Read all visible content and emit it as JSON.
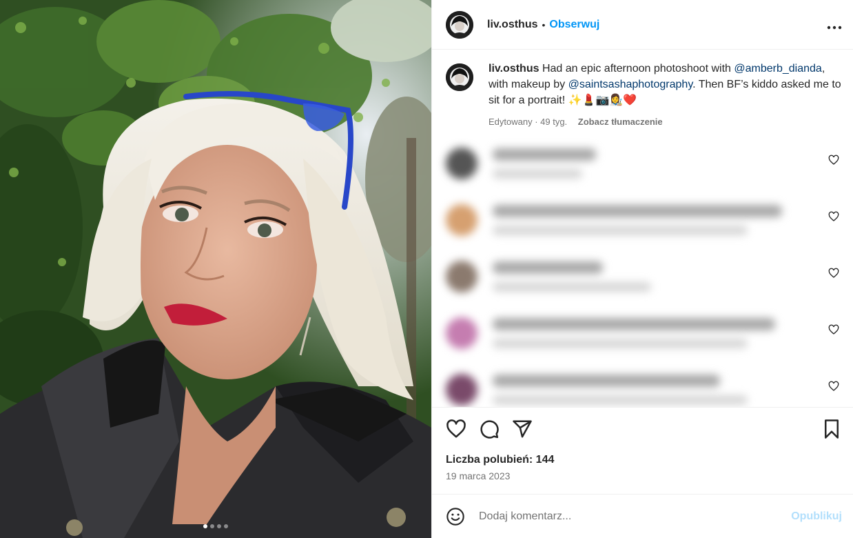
{
  "post": {
    "username": "liv.osthus",
    "separator": "•",
    "follow_label": "Obserwuj",
    "more_label": "•••"
  },
  "caption": {
    "username": "liv.osthus",
    "text_1": "Had an epic afternoon photoshoot with",
    "mention_1": "@amberb_dianda",
    "text_2": ", with makeup by",
    "mention_2": "@saintsashaphotography",
    "text_3": ". Then BF’s kiddo asked me to sit for a portrait!",
    "emojis": "✨💄📷👩‍🎨❤️",
    "edited": "Edytowany · 49 tyg.",
    "translate": "Zobacz tłumaczenie"
  },
  "likes": "Liczba polubień: 144",
  "date": "19 marca 2023",
  "comment_box": {
    "placeholder": "Dodaj komentarz...",
    "publish_label": "Opublikuj"
  },
  "carousel": {
    "count": 4,
    "active_index": 0
  },
  "colors": {
    "accent": "#0095f6",
    "mention": "#00376b",
    "publish_disabled": "#b2dffc",
    "muted_text": "#737373"
  },
  "icons": [
    "more-options-icon",
    "like-icon",
    "comment-icon",
    "share-icon",
    "save-icon",
    "emoji-icon",
    "comment-like-icon"
  ]
}
